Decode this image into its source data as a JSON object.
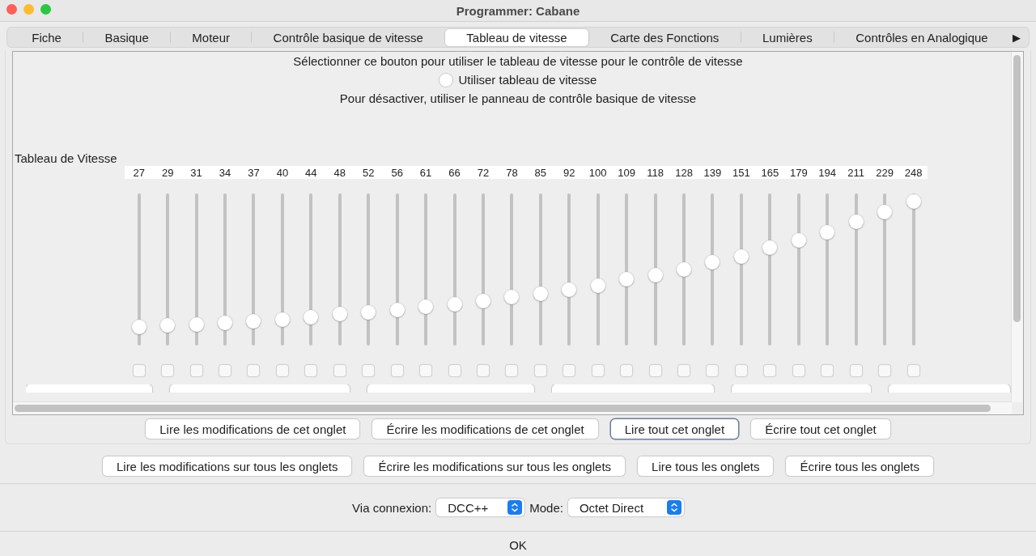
{
  "window": {
    "title": "Programmer: Cabane"
  },
  "tabs": [
    {
      "label": "Fiche",
      "selected": false
    },
    {
      "label": "Basique",
      "selected": false
    },
    {
      "label": "Moteur",
      "selected": false
    },
    {
      "label": "Contrôle basique de vitesse",
      "selected": false
    },
    {
      "label": "Tableau de vitesse",
      "selected": true
    },
    {
      "label": "Carte des Fonctions",
      "selected": false
    },
    {
      "label": "Lumières",
      "selected": false
    },
    {
      "label": "Contrôles en Analogique",
      "selected": false
    }
  ],
  "tab_scroll": "▶",
  "panel": {
    "intro": "Sélectionner ce bouton pour utiliser le tableau de vitesse pour le contrôle de vitesse",
    "radio": {
      "label": "Utiliser tableau de vitesse",
      "checked": false
    },
    "note": "Pour désactiver, utiliser le panneau de contrôle basique de vitesse",
    "table_title": "Tableau de Vitesse",
    "steps": [
      {
        "value": "27",
        "level": 0.1,
        "checked": false
      },
      {
        "value": "29",
        "level": 0.11,
        "checked": false
      },
      {
        "value": "31",
        "level": 0.12,
        "checked": false
      },
      {
        "value": "34",
        "level": 0.13,
        "checked": false
      },
      {
        "value": "37",
        "level": 0.14,
        "checked": false
      },
      {
        "value": "40",
        "level": 0.15,
        "checked": false
      },
      {
        "value": "44",
        "level": 0.17,
        "checked": false
      },
      {
        "value": "48",
        "level": 0.19,
        "checked": false
      },
      {
        "value": "52",
        "level": 0.2,
        "checked": false
      },
      {
        "value": "56",
        "level": 0.22,
        "checked": false
      },
      {
        "value": "61",
        "level": 0.24,
        "checked": false
      },
      {
        "value": "66",
        "level": 0.26,
        "checked": false
      },
      {
        "value": "72",
        "level": 0.28,
        "checked": false
      },
      {
        "value": "78",
        "level": 0.31,
        "checked": false
      },
      {
        "value": "85",
        "level": 0.33,
        "checked": false
      },
      {
        "value": "92",
        "level": 0.36,
        "checked": false
      },
      {
        "value": "100",
        "level": 0.39,
        "checked": false
      },
      {
        "value": "109",
        "level": 0.43,
        "checked": false
      },
      {
        "value": "118",
        "level": 0.46,
        "checked": false
      },
      {
        "value": "128",
        "level": 0.5,
        "checked": false
      },
      {
        "value": "139",
        "level": 0.55,
        "checked": false
      },
      {
        "value": "151",
        "level": 0.59,
        "checked": false
      },
      {
        "value": "165",
        "level": 0.65,
        "checked": false
      },
      {
        "value": "179",
        "level": 0.7,
        "checked": false
      },
      {
        "value": "194",
        "level": 0.76,
        "checked": false
      },
      {
        "value": "211",
        "level": 0.83,
        "checked": false
      },
      {
        "value": "229",
        "level": 0.9,
        "checked": false
      },
      {
        "value": "248",
        "level": 0.97,
        "checked": false
      }
    ],
    "clipped_buttons": [
      {
        "kind": "button"
      },
      {
        "kind": "button"
      },
      {
        "kind": "button"
      },
      {
        "kind": "button"
      },
      {
        "kind": "button"
      },
      {
        "kind": "button"
      }
    ]
  },
  "tab_buttons": [
    {
      "label": "Lire les modifications de cet onglet",
      "selected": false
    },
    {
      "label": "Écrire les modifications de cet onglet",
      "selected": false
    },
    {
      "label": "Lire tout cet onglet",
      "selected": true
    },
    {
      "label": "Écrire tout cet onglet",
      "selected": false
    }
  ],
  "all_buttons": [
    {
      "label": "Lire les modifications sur tous les onglets"
    },
    {
      "label": "Écrire les modifications sur tous les onglets"
    },
    {
      "label": "Lire tous les onglets"
    },
    {
      "label": "Écrire tous les onglets"
    }
  ],
  "connection": {
    "label": "Via connexion:",
    "value": "DCC++",
    "mode_label": "Mode:",
    "mode_value": "Octet Direct"
  },
  "ok": "OK"
}
